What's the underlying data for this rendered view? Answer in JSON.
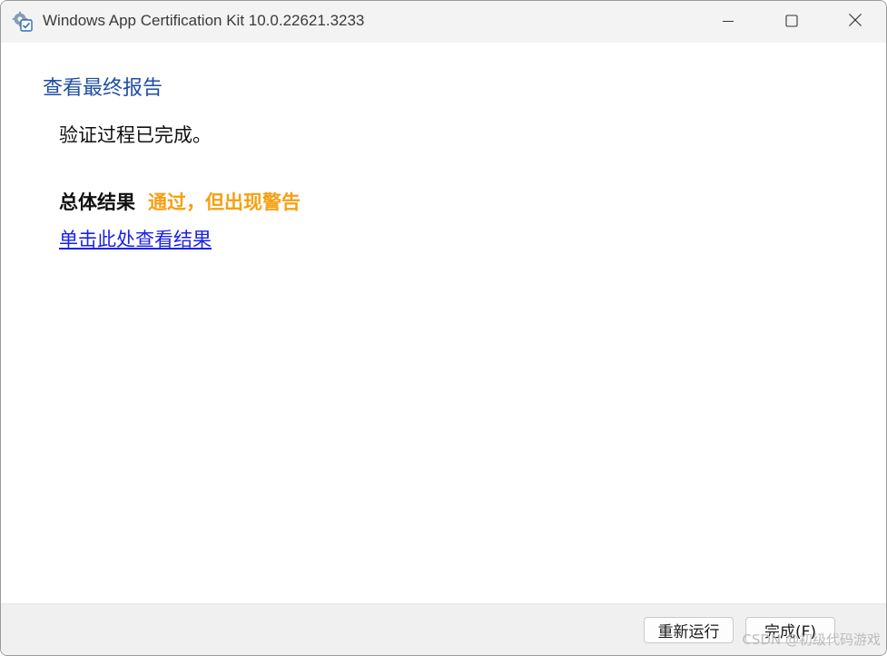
{
  "window": {
    "title": "Windows App Certification Kit 10.0.22621.3233",
    "icon": "certification-kit-icon",
    "controls": {
      "minimize": "minimize-icon",
      "maximize": "maximize-icon",
      "close": "close-icon"
    }
  },
  "main": {
    "heading": "查看最终报告",
    "status_text": "验证过程已完成。",
    "result_label": "总体结果",
    "result_value": "通过，但出现警告",
    "result_link": "单击此处查看结果"
  },
  "footer": {
    "rerun_label": "重新运行",
    "done_label": "完成(F)"
  },
  "watermark": "CSDN @初级代码游戏",
  "colors": {
    "heading": "#1e4ea3",
    "warning": "#f5a012",
    "link": "#1a22e6"
  }
}
